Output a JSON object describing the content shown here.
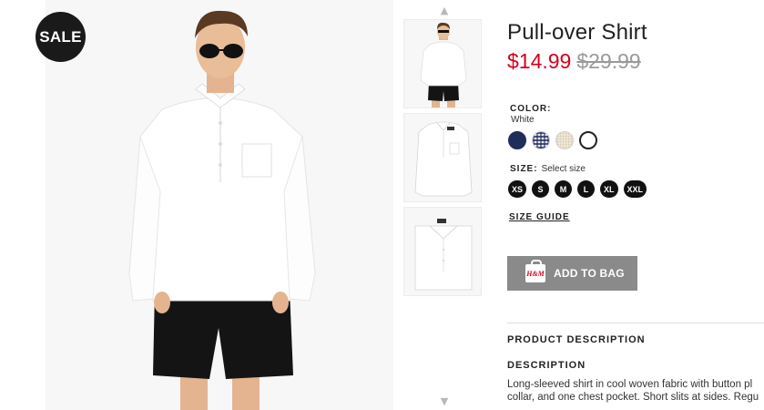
{
  "badge": {
    "sale": "SALE"
  },
  "product": {
    "title": "Pull-over Shirt",
    "price_sale": "$14.99",
    "price_original": "$29.99"
  },
  "color": {
    "label": "COLOR:",
    "selected": "White",
    "swatches": [
      {
        "name": "navy",
        "hex": "#1f2d5a"
      },
      {
        "name": "gingham",
        "hex": "#e8eaf2"
      },
      {
        "name": "beige",
        "hex": "#efe8d8"
      },
      {
        "name": "white",
        "hex": "#ffffff"
      }
    ]
  },
  "size": {
    "label": "SIZE:",
    "placeholder": "Select size",
    "options": [
      "XS",
      "S",
      "M",
      "L",
      "XL",
      "XXL"
    ],
    "guide_label": "SIZE GUIDE"
  },
  "cart": {
    "add_label": "ADD TO BAG",
    "bag_brand": "H&M"
  },
  "description": {
    "section_heading": "PRODUCT DESCRIPTION",
    "heading": "DESCRIPTION",
    "line1": "Long-sleeved shirt in cool woven fabric with button pl",
    "line2": "collar, and one chest pocket. Short slits at sides. Regu"
  },
  "thumbnails": {
    "up_icon": "chevron-up-icon",
    "down_icon": "chevron-down-icon"
  }
}
